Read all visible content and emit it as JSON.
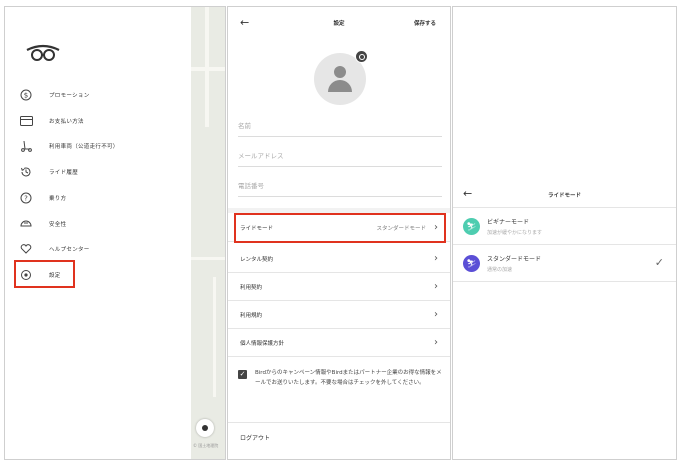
{
  "menu": {
    "items": [
      {
        "icon": "dollar-circle-icon",
        "label": "プロモーション"
      },
      {
        "icon": "credit-card-icon",
        "label": "お支払い方法"
      },
      {
        "icon": "scooter-icon",
        "label": "利用車両（公道走行不可）"
      },
      {
        "icon": "history-icon",
        "label": "ライド履歴"
      },
      {
        "icon": "help-circle-icon",
        "label": "乗り方"
      },
      {
        "icon": "helmet-icon",
        "label": "安全性"
      },
      {
        "icon": "heart-icon",
        "label": "ヘルプセンター"
      },
      {
        "icon": "gear-icon",
        "label": "設定"
      }
    ],
    "map_attribution": "© 国土地理院"
  },
  "settings": {
    "title": "設定",
    "save_label": "保存する",
    "fields": {
      "name_placeholder": "名前",
      "email_placeholder": "メールアドレス",
      "phone_placeholder": "電話番号"
    },
    "ride_mode": {
      "label": "ライドモード",
      "value": "スタンダードモード"
    },
    "rows": [
      "レンタル契約",
      "利用契約",
      "利用規約",
      "個人情報保護方針"
    ],
    "consent_text": "Birdからのキャンペーン情報やBirdまたはパートナー企業のお得な情報をメールでお送りいたします。不要な場合はチェックを外してください。",
    "consent_checked": true,
    "logout_label": "ログアウト"
  },
  "ride_mode_screen": {
    "title": "ライドモード",
    "options": [
      {
        "name": "ビギナーモード",
        "desc": "加速が緩やかになります",
        "color": "#4ecdb0",
        "selected": false
      },
      {
        "name": "スタンダードモード",
        "desc": "通常の加速",
        "color": "#5b4fd6",
        "selected": true
      }
    ]
  },
  "colors": {
    "highlight": "#e0321e"
  }
}
